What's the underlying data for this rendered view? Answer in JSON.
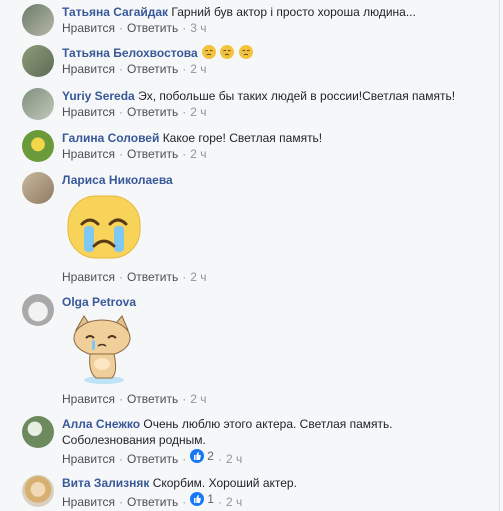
{
  "action_labels": {
    "like": "Нравится",
    "reply": "Ответить"
  },
  "comments": [
    {
      "name": "Татьяна Сагайдак",
      "text": "Гарний був актор і просто хороша людина...",
      "time": "3 ч"
    },
    {
      "name": "Татьяна Белохвостова",
      "text": "",
      "emoji": [
        "crying-face",
        "crying-face",
        "crying-face"
      ],
      "time": "2 ч"
    },
    {
      "name": "Yuriy Sereda",
      "text": "Эх, побольше бы таких людей в россии!Светлая память!",
      "time": "2 ч"
    },
    {
      "name": "Галина Соловей",
      "text": "Какое горе! Светлая память!",
      "time": "2 ч"
    },
    {
      "name": "Лариса Николаева",
      "text": "",
      "sticker": "crying-face-sticker",
      "time": "2 ч"
    },
    {
      "name": "Olga Petrova",
      "text": "",
      "sticker": "sad-cat-sticker",
      "time": "2 ч"
    },
    {
      "name": "Алла Снежко",
      "text": "Очень люблю этого актера. Светлая память.",
      "text_line2": "Соболезнования родным.",
      "likes": "2",
      "time": "2 ч"
    },
    {
      "name": "Вита Зализняк",
      "text": "Скорбим. Хороший актер.",
      "likes": "1",
      "time": "2 ч"
    }
  ],
  "colors": {
    "name": "#385898",
    "like_badge": "#1877f2",
    "action": "#4b4f56",
    "background": "#f6f7f9"
  }
}
